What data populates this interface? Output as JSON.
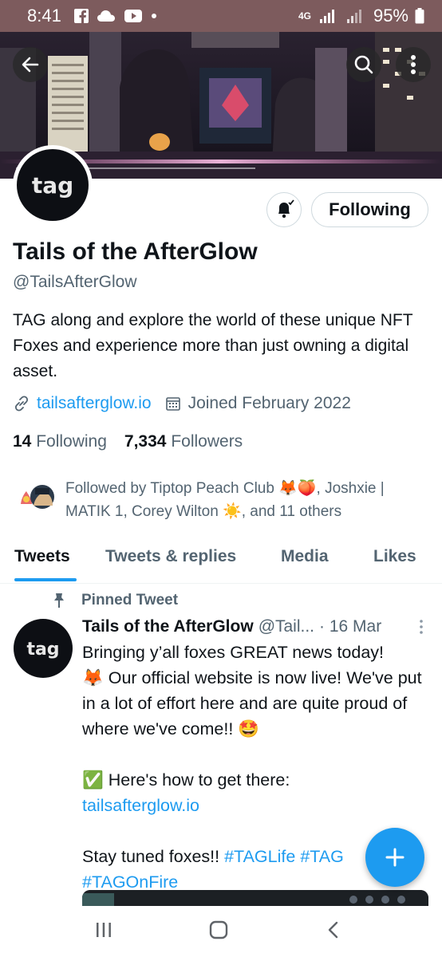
{
  "status_bar": {
    "time": "8:41",
    "network": "4G",
    "battery": "95%"
  },
  "profile": {
    "name": "Tails of the AfterGlow",
    "handle": "@TailsAfterGlow",
    "avatar_text": "tag",
    "bio": "TAG along and explore the world of these unique NFT Foxes and experience more than just owning a digital asset.",
    "website": "tailsafterglow.io",
    "joined": "Joined February 2022",
    "following_count": "14",
    "following_label": "Following",
    "followers_count": "7,334",
    "followers_label": "Followers",
    "follow_button": "Following",
    "followed_by_1": "Followed by Tiptop Peach Club 🦊🍑, Joshxie |",
    "followed_by_2": "MATIK 1, Corey Wilton ☀️, and 11 others"
  },
  "tabs": [
    {
      "label": "Tweets",
      "active": true
    },
    {
      "label": "Tweets & replies",
      "active": false
    },
    {
      "label": "Media",
      "active": false
    },
    {
      "label": "Likes",
      "active": false
    }
  ],
  "tweet": {
    "pinned_label": "Pinned Tweet",
    "author": "Tails of the AfterGlow",
    "handle": "@Tail...",
    "date": "· 16 Mar",
    "line1": "Bringing y’all foxes GREAT news today!",
    "line2": "🦊 Our official website is now live! We've put in a lot of effort here and are quite proud of where we've come!! 🤩",
    "line3": "✅ Here's how to get there:",
    "link": "tailsafterglow.io",
    "line4_prefix": "Stay tuned foxes!! ",
    "hashtag1": "#TAGLife",
    "hashtag2": "#TAG",
    "hashtag3": "#TAGOnFire"
  },
  "icons": {
    "back": "arrow-left-icon",
    "search": "search-icon",
    "more": "more-vertical-icon",
    "bell": "bell-icon",
    "link": "link-icon",
    "calendar": "calendar-icon",
    "pin": "pin-icon",
    "compose": "plus-icon"
  },
  "colors": {
    "accent": "#1d9bf0",
    "status_bar": "#7d5b5d",
    "text_primary": "#0f1419",
    "text_secondary": "#536471"
  }
}
